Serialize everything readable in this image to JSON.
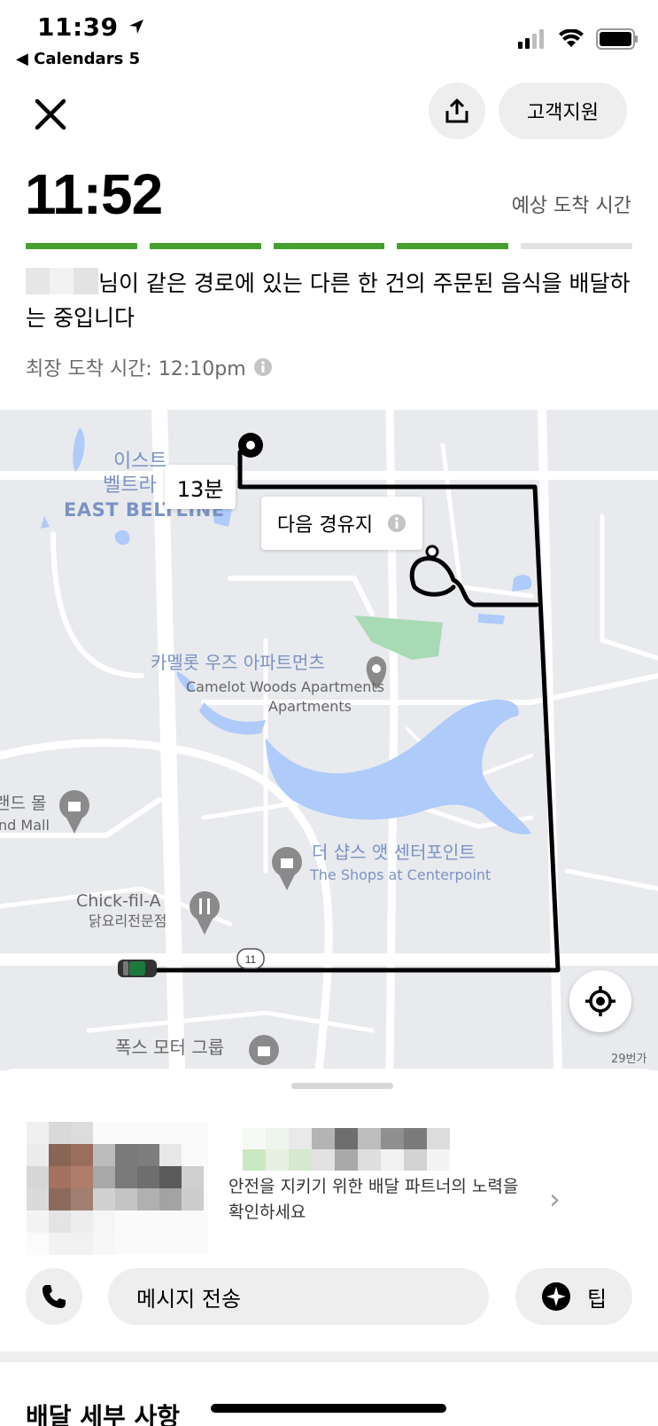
{
  "status_bar": {
    "time": "11:39",
    "back_app": "Calendars 5"
  },
  "header": {
    "support_label": "고객지원"
  },
  "eta": {
    "time": "11:52",
    "label": "예상 도착 시간",
    "progress_segments": [
      {
        "color": "#43a02c"
      },
      {
        "color": "#43a02c"
      },
      {
        "color": "#43a02c"
      },
      {
        "color": "#43a02c"
      },
      {
        "color": "#e2e2e2"
      }
    ]
  },
  "status_message": {
    "text": "님이 같은 경로에 있는 다른 한 건의 주문된 음식을 배달하는 중입니다",
    "latest_arrival": "최장 도착 시간: 12:10pm"
  },
  "map": {
    "badge_time": "13분",
    "badge_next": "다음 경유지",
    "places": [
      {
        "ko": "이스트",
        "en": ""
      },
      {
        "ko": "벨트라",
        "en": "EAST BELTLINE"
      },
      {
        "ko": "카멜롯 우즈 아파트먼츠",
        "en": "Camelot Woods Apartments"
      },
      {
        "ko": "랜드 몰",
        "en": "nd Mall"
      },
      {
        "ko": "더 샵스 앳 센터포인트",
        "en": "The Shops at Centerpoint"
      },
      {
        "ko": "닭요리전문점",
        "en": "Chick-fil-A"
      },
      {
        "ko": "폭스 모터 그룹",
        "en": ""
      },
      {
        "ko": "29번가",
        "en": ""
      }
    ],
    "road_shield": "11",
    "colors": {
      "route": "#000000",
      "water": "#aecbfa",
      "park": "#a8dab5",
      "road": "#ffffff"
    }
  },
  "courier": {
    "safety_text": "안전을 지키기 위한 배달 파트너의 노력을 확인하세요",
    "message_label": "메시지 전송",
    "tip_label": "팁"
  },
  "details": {
    "title": "배달 세부 사항"
  },
  "icons": [
    "location-arrow-icon",
    "back-triangle-icon",
    "signal-icon",
    "wifi-icon",
    "battery-icon",
    "close-icon",
    "share-icon",
    "info-icon",
    "map-pin-icon",
    "shopping-bag-icon",
    "restaurant-icon",
    "car-icon",
    "locate-icon",
    "chevron-right-icon",
    "phone-icon",
    "tip-star-icon"
  ]
}
